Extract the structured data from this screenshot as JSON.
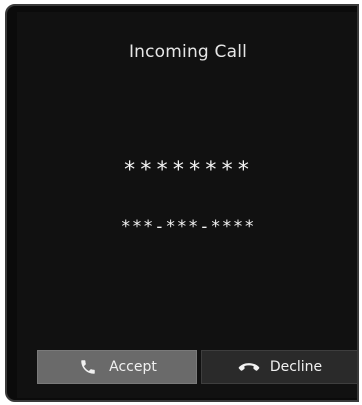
{
  "call": {
    "title": "Incoming Call",
    "caller_name": "********",
    "caller_number": "***-***-****"
  },
  "actions": {
    "accept_label": "Accept",
    "accept_icon": "phone-handset-icon",
    "decline_label": "Decline",
    "decline_icon": "phone-hangup-icon"
  },
  "colors": {
    "screen_background": "#111111",
    "accept_button": "#6a6a6a",
    "decline_button": "#2a2a2a",
    "text": "#f2f2f2"
  }
}
